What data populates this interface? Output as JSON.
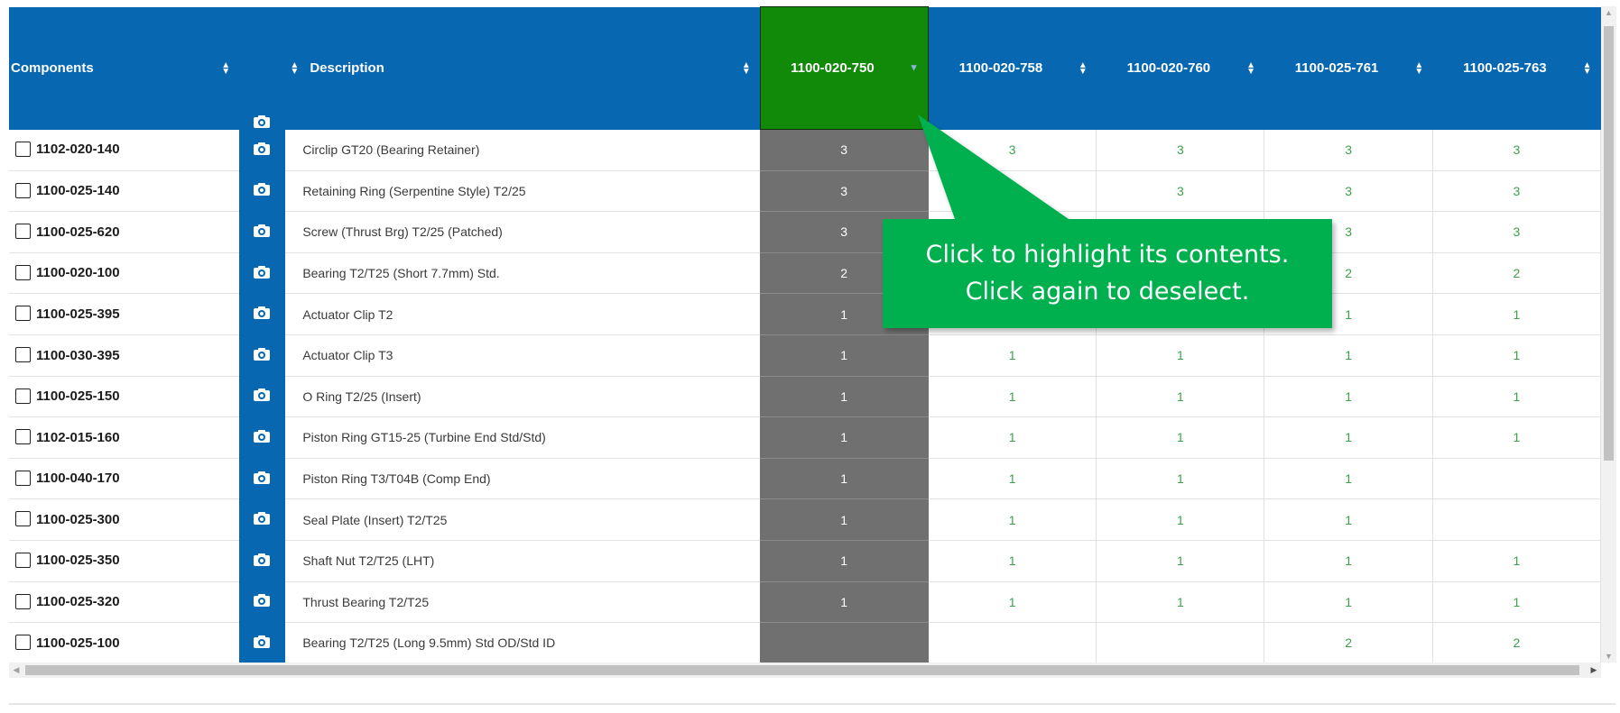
{
  "header": {
    "components_label": "Components",
    "description_label": "Description",
    "camera_icon": "camera-icon",
    "columns": [
      "1100-020-750",
      "1100-020-758",
      "1100-020-760",
      "1100-025-761",
      "1100-025-763"
    ],
    "selected_column": "1100-020-750"
  },
  "rows": [
    {
      "part": "1102-020-140",
      "description": "Circlip GT20 (Bearing Retainer)",
      "qty": [
        "3",
        "3",
        "3",
        "3",
        "3"
      ]
    },
    {
      "part": "1100-025-140",
      "description": "Retaining Ring (Serpentine Style) T2/25",
      "qty": [
        "3",
        "",
        "3",
        "3",
        "3"
      ]
    },
    {
      "part": "1100-025-620",
      "description": "Screw (Thrust Brg) T2/25 (Patched)",
      "qty": [
        "3",
        "",
        "",
        "3",
        "3"
      ]
    },
    {
      "part": "1100-020-100",
      "description": "Bearing T2/T25 (Short 7.7mm) Std.",
      "qty": [
        "2",
        "",
        "",
        "2",
        "2"
      ]
    },
    {
      "part": "1100-025-395",
      "description": "Actuator Clip T2",
      "qty": [
        "1",
        "",
        "",
        "1",
        "1"
      ]
    },
    {
      "part": "1100-030-395",
      "description": "Actuator Clip T3",
      "qty": [
        "1",
        "1",
        "1",
        "1",
        "1"
      ]
    },
    {
      "part": "1100-025-150",
      "description": "O Ring T2/25 (Insert)",
      "qty": [
        "1",
        "1",
        "1",
        "1",
        "1"
      ]
    },
    {
      "part": "1102-015-160",
      "description": "Piston Ring GT15-25 (Turbine End Std/Std)",
      "qty": [
        "1",
        "1",
        "1",
        "1",
        "1"
      ]
    },
    {
      "part": "1100-040-170",
      "description": "Piston Ring T3/T04B (Comp End)",
      "qty": [
        "1",
        "1",
        "1",
        "1",
        ""
      ]
    },
    {
      "part": "1100-025-300",
      "description": "Seal Plate (Insert) T2/T25",
      "qty": [
        "1",
        "1",
        "1",
        "1",
        ""
      ]
    },
    {
      "part": "1100-025-350",
      "description": "Shaft Nut T2/T25 (LHT)",
      "qty": [
        "1",
        "1",
        "1",
        "1",
        "1"
      ]
    },
    {
      "part": "1100-025-320",
      "description": "Thrust Bearing T2/T25",
      "qty": [
        "1",
        "1",
        "1",
        "1",
        "1"
      ]
    },
    {
      "part": "1100-025-100",
      "description": "Bearing T2/T25 (Long 9.5mm) Std OD/Std ID",
      "qty": [
        "",
        "",
        "",
        "2",
        "2"
      ]
    }
  ],
  "callout": {
    "line1": "Click to highlight its contents.",
    "line2": "Click again to deselect."
  },
  "colors": {
    "header_blue": "#0767b1",
    "selected_green": "#118a0a",
    "selected_cell_gray": "#707070",
    "qty_green": "#3aa34a",
    "callout_green": "#00b050"
  }
}
